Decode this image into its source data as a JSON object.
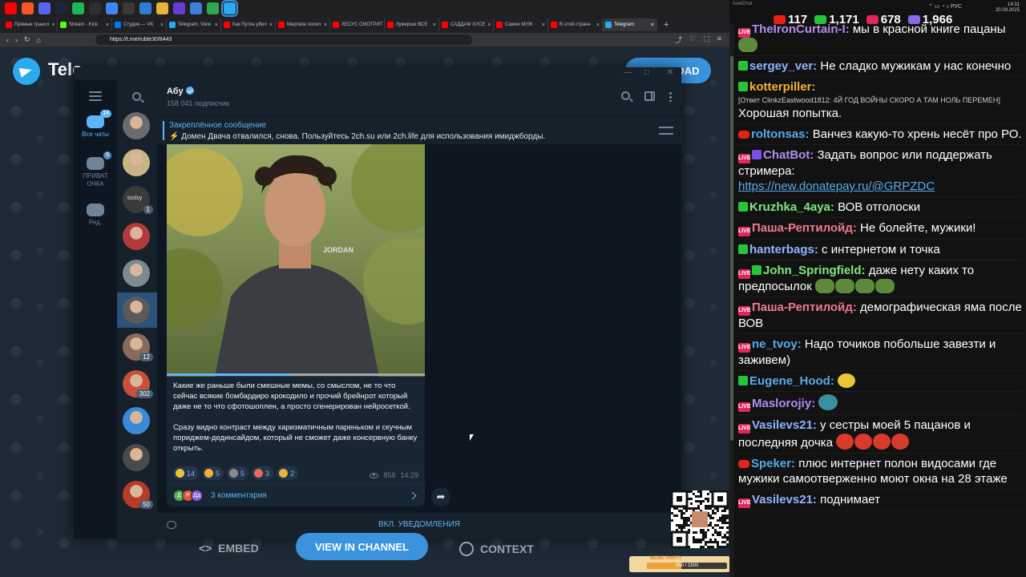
{
  "taskbar": {
    "icons": [
      {
        "name": "youtube-icon",
        "color": "#ff0000"
      },
      {
        "name": "brave-icon",
        "color": "#fb542b"
      },
      {
        "name": "discord-icon",
        "color": "#5865f2"
      },
      {
        "name": "steam-icon",
        "color": "#1b2838"
      },
      {
        "name": "spotify-icon",
        "color": "#1db954"
      },
      {
        "name": "obs-icon",
        "color": "#302e31"
      },
      {
        "name": "chrome-icon",
        "color": "#4285f4"
      },
      {
        "name": "app-icon",
        "color": "#3a3a3a"
      },
      {
        "name": "sync-icon",
        "color": "#2d7dd2"
      },
      {
        "name": "folder-icon",
        "color": "#e8b33a"
      },
      {
        "name": "game-icon",
        "color": "#6a3ad8"
      },
      {
        "name": "media-icon",
        "color": "#3a7fd8"
      },
      {
        "name": "chat-icon",
        "color": "#2fa84f"
      },
      {
        "name": "telegram-icon",
        "color": "#2aabee"
      }
    ]
  },
  "browser": {
    "tabs": [
      {
        "label": "Прямые трансл",
        "color": "#ff0000"
      },
      {
        "label": "Stream - Kick",
        "color": "#53fc18"
      },
      {
        "label": "Студия — VK",
        "color": "#0077ff"
      },
      {
        "label": "Telegram: View",
        "color": "#2aabee"
      },
      {
        "label": "Как Путин убил",
        "color": "#ff0000"
      },
      {
        "label": "Мертвое посел",
        "color": "#ff0000"
      },
      {
        "label": "ХЕСУС СМОТРИТ",
        "color": "#ff0000"
      },
      {
        "label": "Зумерши ВСЕ",
        "color": "#ff0000"
      },
      {
        "label": "САДДАМ ХУСЕ",
        "color": "#ff0000"
      },
      {
        "label": "Самое МУЖ",
        "color": "#ff0000"
      },
      {
        "label": "В этой стране",
        "color": "#ff0000"
      },
      {
        "label": "Telegram:",
        "color": "#2aabee",
        "active": true
      }
    ],
    "url": "https://t.me/ruble30/8443"
  },
  "tg_page": {
    "brand": "Tele",
    "download": "DOWNLOAD"
  },
  "telegram": {
    "folders": [
      {
        "label": "Все чаты",
        "badge": "14",
        "active": true
      },
      {
        "label": "ПРИВАТ ОЧКА",
        "badge": "5",
        "active": false
      },
      {
        "label": "Ред.",
        "badge": "",
        "active": false
      }
    ],
    "chats": [
      {
        "color": "#6b6b6b",
        "badge": ""
      },
      {
        "color": "#c9b48a",
        "badge": ""
      },
      {
        "color": "#3a3a3a",
        "badge": "1",
        "text": "toolsy"
      },
      {
        "color": "#b23a3a",
        "badge": ""
      },
      {
        "color": "#7a8a90",
        "badge": ""
      },
      {
        "color": "#5a5a5a",
        "badge": "",
        "selected": true
      },
      {
        "color": "#8a6a5a",
        "badge": "12"
      },
      {
        "color": "#c8503a",
        "badge": "302"
      },
      {
        "color": "#3a8ad8",
        "badge": ""
      },
      {
        "color": "#4a4a4a",
        "badge": ""
      },
      {
        "color": "#b83a2a",
        "badge": "50"
      }
    ],
    "channel": {
      "name": "Абу",
      "subscribers": "158 041 подписчик"
    },
    "pinned": {
      "title": "Закреплённое сообщение",
      "text": "Домен Двача отвалился, снова.  Пользуйтесь 2ch.su или 2ch.life для использования имиджборды."
    },
    "post": {
      "video_progress": 0.48,
      "paragraph1": "Какие же раньше были смешные мемы, со смыслом, не то что сейчас всякие бомбардиро крокодило и прочий брейнрот который даже не то что сфотошоплен, а просто сгенерирован нейросеткой.",
      "paragraph2": "Сразу видно контраст между харизматичным пареньком и скучным пориджем-дединсайдом, который не сможет даже консервную банку открыть.",
      "reactions": [
        {
          "emoji": "laugh-emoji",
          "color": "#f0c23a",
          "count": "14"
        },
        {
          "emoji": "thumbs-up-emoji",
          "color": "#f0b03a",
          "count": "5"
        },
        {
          "emoji": "custom-emoji",
          "color": "#8a8a8a",
          "count": "5"
        },
        {
          "emoji": "clown-emoji",
          "color": "#e86a5a",
          "count": "3"
        },
        {
          "emoji": "like-emoji",
          "color": "#f0b03a",
          "count": "2"
        }
      ],
      "views": "858",
      "time": "14:29",
      "comment_avatars": [
        {
          "letter": "Д",
          "color": "#4caf50"
        },
        {
          "letter": "Р",
          "color": "#e0563a"
        },
        {
          "letter": "Дд",
          "color": "#8a5ad8"
        }
      ],
      "comments": "3 комментария"
    },
    "footer": {
      "notify": "ВКЛ. УВЕДОМЛЕНИЯ"
    }
  },
  "stream_bar": {
    "embed": "EMBED",
    "view": "VIEW IN CHANNEL",
    "context": "CONTEXT",
    "meme_label": "MEME PARTY",
    "meme_count": "650 / 1500",
    "meme_progress": 0.43
  },
  "chat": {
    "app_label": "AxelChat",
    "stats": [
      {
        "icon": "youtube-icon",
        "color": "#e62117",
        "value": "117"
      },
      {
        "icon": "kick-icon",
        "color": "#27c43a",
        "value": "1,171"
      },
      {
        "icon": "vk-live-icon",
        "color": "#e0285a",
        "value": "678"
      },
      {
        "icon": "viewers-icon",
        "color": "#8a6ae6",
        "value": "1,966"
      }
    ],
    "system": {
      "lang": "РУС",
      "time": "14:31",
      "date": "20.09.2025"
    },
    "messages": [
      {
        "badges": [
          "vk"
        ],
        "user": "TheIronCurtain-I",
        "color": "#b48cf0",
        "text": "мы в красной книге пацаны",
        "emotes": [
          "pepe"
        ]
      },
      {
        "badges": [
          "kick"
        ],
        "user": "sergey_ver",
        "color": "#8fb4ff",
        "text": "Не сладко мужикам у нас конечно"
      },
      {
        "badges": [
          "kick"
        ],
        "user": "kotterpiller",
        "color": "#f2b13a",
        "text": "Хорошая попытка.",
        "reply": "[Ответ ClinkzEastwood1812: 4Й ГОД ВОЙНЫ СКОРО А ТАМ НОЛЬ ПЕРЕМЕН]"
      },
      {
        "badges": [
          "yt"
        ],
        "user": "roltonsas",
        "color": "#5aa9e6",
        "text": "Ванчез какую-то хрень несёт про РО."
      },
      {
        "badges": [
          "vk",
          "bot"
        ],
        "user": "ChatBot",
        "color": "#b48cf0",
        "text": "Задать вопрос или поддержать стримера:",
        "link": "https://new.donatepay.ru/@GRPZDC"
      },
      {
        "badges": [
          "kick"
        ],
        "user": "Kruzhka_4aya",
        "color": "#7de87d",
        "text": "ВОВ отголоски"
      },
      {
        "badges": [
          "vk"
        ],
        "user": "Паша-Рептилойд",
        "color": "#f07a8c",
        "text": "Не болейте, мужики!"
      },
      {
        "badges": [
          "kick"
        ],
        "user": "hanterbags",
        "color": "#8fb4ff",
        "text": "с интернетом и точка"
      },
      {
        "badges": [
          "vk",
          "check"
        ],
        "user": "John_Springfield",
        "color": "#7de87d",
        "text": "даже нету каких то предпосылок",
        "emotes": [
          "pepe",
          "pepe",
          "pepe",
          "pepe"
        ]
      },
      {
        "badges": [
          "vk"
        ],
        "user": "Паша-Рептилойд",
        "color": "#f07a8c",
        "text": "демографическая яма после ВОВ"
      },
      {
        "badges": [
          "vk"
        ],
        "user": "ne_tvoy",
        "color": "#5aa9e6",
        "text": "Надо точиков побольше завезти и заживем)"
      },
      {
        "badges": [
          "kick"
        ],
        "user": "Eugene_Hood",
        "color": "#5aa9e6",
        "text": "",
        "emotes": [
          "blob"
        ]
      },
      {
        "badges": [
          "vk"
        ],
        "user": "Maslorojiy",
        "color": "#b48cf0",
        "text": "",
        "emotes": [
          "wave"
        ]
      },
      {
        "badges": [
          "vk"
        ],
        "user": "Vasilevs21",
        "color": "#8fb4ff",
        "text": "у сестры моей 5 пацанов и последняя дочка",
        "emotes": [
          "heart",
          "heart",
          "heart",
          "heart"
        ]
      },
      {
        "badges": [
          "yt"
        ],
        "user": "Speker",
        "color": "#5aa9e6",
        "text": "плюс интернет полон видосами где мужики самоотверженно моют окна на 28 этаже"
      },
      {
        "badges": [
          "vk"
        ],
        "user": "Vasilevs21",
        "color": "#8fb4ff",
        "text": "поднимает"
      }
    ]
  }
}
